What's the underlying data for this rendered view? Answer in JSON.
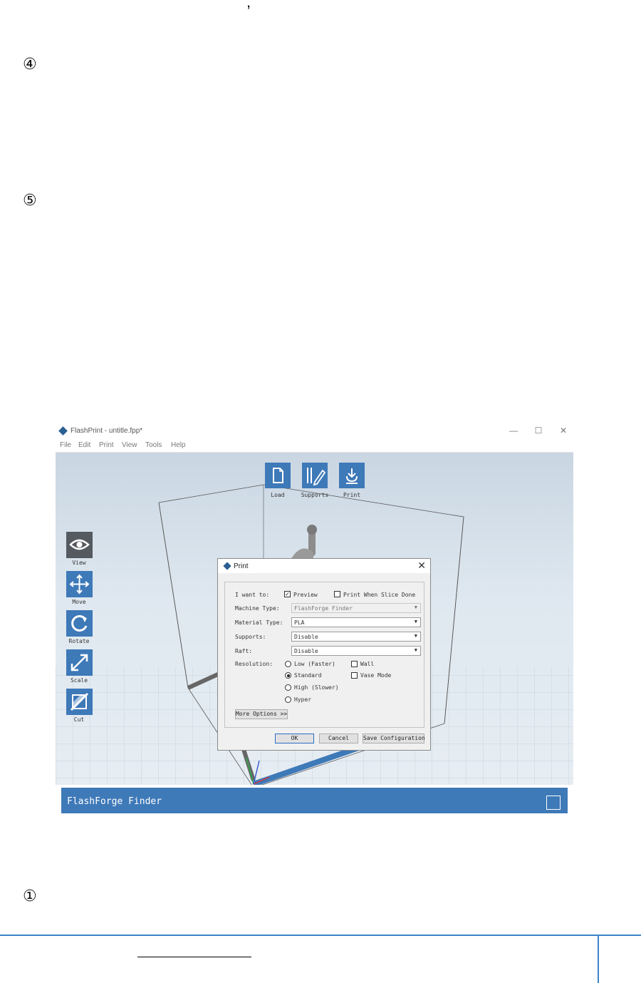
{
  "document": {
    "punctuation": ",",
    "steps": [
      "④",
      "⑤",
      "①"
    ]
  },
  "app": {
    "window_title": "FlashPrint - untitle.fpp*",
    "window_controls": [
      "—",
      "☐",
      "✕"
    ],
    "menu": [
      "File",
      "Edit",
      "Print",
      "View",
      "Tools",
      "Help"
    ],
    "toolbar": [
      {
        "label": "Load",
        "icon": "load-file-icon"
      },
      {
        "label": "Supports",
        "icon": "supports-edit-icon"
      },
      {
        "label": "Print",
        "icon": "print-download-icon"
      }
    ],
    "side_tools": [
      {
        "label": "View",
        "icon": "eye-icon"
      },
      {
        "label": "Move",
        "icon": "move-arrows-icon"
      },
      {
        "label": "Rotate",
        "icon": "rotate-icon"
      },
      {
        "label": "Scale",
        "icon": "scale-icon"
      },
      {
        "label": "Cut",
        "icon": "cut-icon"
      }
    ],
    "status_bar": {
      "machine_name": "FlashForge Finder"
    }
  },
  "dialog": {
    "title": "Print",
    "close": "✕",
    "i_want_to_label": "I want to:",
    "preview_label": "Preview",
    "preview_checked": true,
    "print_when_slice_done_label": "Print When Slice Done",
    "print_when_slice_done_checked": false,
    "machine_type_label": "Machine Type:",
    "machine_type_value": "FlashForge Finder",
    "material_type_label": "Material Type:",
    "material_type_value": "PLA",
    "supports_label": "Supports:",
    "supports_value": "Disable",
    "raft_label": "Raft:",
    "raft_value": "Disable",
    "resolution_label": "Resolution:",
    "resolutions": [
      {
        "label": "Low (Faster)",
        "selected": false
      },
      {
        "label": "Standard",
        "selected": true
      },
      {
        "label": "High (Slower)",
        "selected": false
      },
      {
        "label": "Hyper",
        "selected": false
      }
    ],
    "wall_label": "Wall",
    "vase_mode_label": "Vase Mode",
    "more_options_label": "More Options >>",
    "ok_label": "OK",
    "cancel_label": "Cancel",
    "save_configuration_label": "Save Configuration"
  },
  "colors": {
    "accent": "#3e79b8",
    "footer_rule": "#3a84c9"
  }
}
